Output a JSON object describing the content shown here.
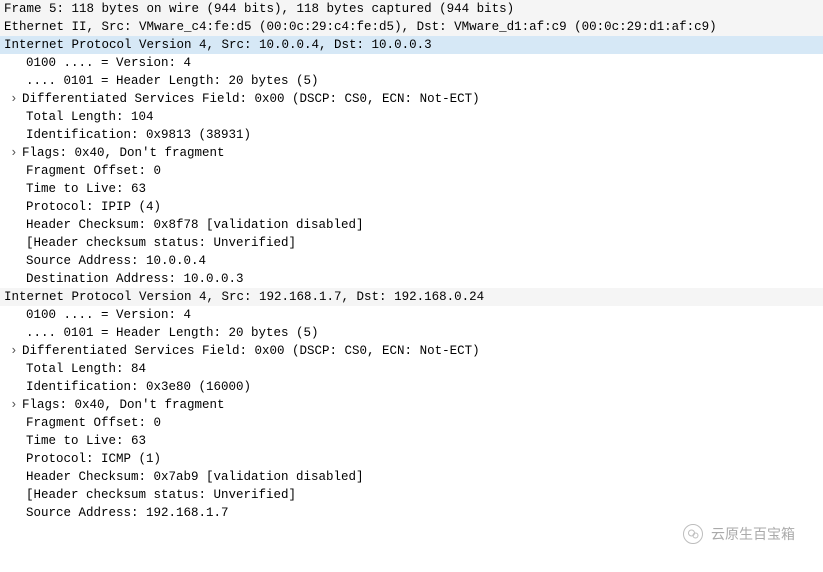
{
  "frame_line": "Frame 5: 118 bytes on wire (944 bits), 118 bytes captured (944 bits)",
  "eth_line": "Ethernet II, Src: VMware_c4:fe:d5 (00:0c:29:c4:fe:d5), Dst: VMware_d1:af:c9 (00:0c:29:d1:af:c9)",
  "outer_ip": {
    "header": "Internet Protocol Version 4, Src: 10.0.0.4, Dst: 10.0.0.3",
    "version": "0100 .... = Version: 4",
    "hdr_len": ".... 0101 = Header Length: 20 bytes (5)",
    "dsf": "Differentiated Services Field: 0x00 (DSCP: CS0, ECN: Not-ECT)",
    "total_len": "Total Length: 104",
    "ident": "Identification: 0x9813 (38931)",
    "flags": "Flags: 0x40, Don't fragment",
    "frag_off": "Fragment Offset: 0",
    "ttl": "Time to Live: 63",
    "proto": "Protocol: IPIP (4)",
    "cksum": "Header Checksum: 0x8f78 [validation disabled]",
    "cksum_status": "[Header checksum status: Unverified]",
    "src": "Source Address: 10.0.0.4",
    "dst": "Destination Address: 10.0.0.3"
  },
  "inner_ip": {
    "header": "Internet Protocol Version 4, Src: 192.168.1.7, Dst: 192.168.0.24",
    "version": "0100 .... = Version: 4",
    "hdr_len": ".... 0101 = Header Length: 20 bytes (5)",
    "dsf": "Differentiated Services Field: 0x00 (DSCP: CS0, ECN: Not-ECT)",
    "total_len": "Total Length: 84",
    "ident": "Identification: 0x3e80 (16000)",
    "flags": "Flags: 0x40, Don't fragment",
    "frag_off": "Fragment Offset: 0",
    "ttl": "Time to Live: 63",
    "proto": "Protocol: ICMP (1)",
    "cksum": "Header Checksum: 0x7ab9 [validation disabled]",
    "cksum_status": "[Header checksum status: Unverified]",
    "src": "Source Address: 192.168.1.7"
  },
  "expander_glyph": "›",
  "watermark_text": "云原生百宝箱"
}
